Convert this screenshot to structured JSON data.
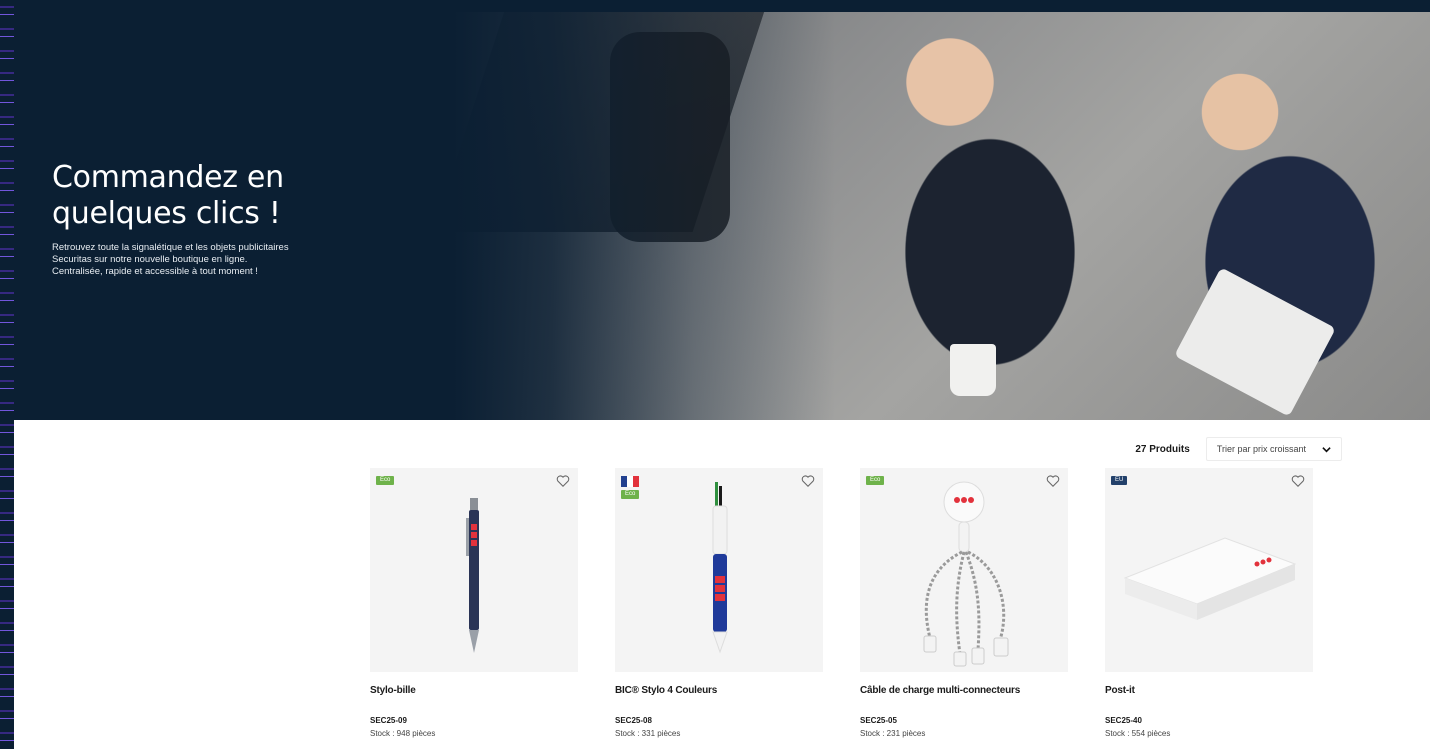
{
  "hero": {
    "title_line1": "Commandez en",
    "title_line2": "quelques clics !",
    "subtitle_line1": "Retrouvez toute la signalétique et les objets publicitaires",
    "subtitle_line2": "Securitas sur notre nouvelle boutique en ligne.",
    "subtitle_line3": "Centralisée, rapide et accessible à tout moment !"
  },
  "toolbar": {
    "count_label": "27 Produits",
    "sort_label": "Trier par prix croissant"
  },
  "products": [
    {
      "name": "Stylo-bille",
      "sku": "SEC25-09",
      "stock": "Stock : 948 pièces",
      "badge": "Eco",
      "flag": false
    },
    {
      "name": "BIC® Stylo 4 Couleurs",
      "sku": "SEC25-08",
      "stock": "Stock : 331 pièces",
      "badge": "Eco",
      "flag": true
    },
    {
      "name": "Câble de charge multi-connecteurs",
      "sku": "SEC25-05",
      "stock": "Stock : 231 pièces",
      "badge": "Eco",
      "flag": false
    },
    {
      "name": "Post-it",
      "sku": "SEC25-40",
      "stock": "Stock : 554 pièces",
      "badge": "EU",
      "flag": false
    }
  ],
  "colors": {
    "hero_bg": "#0b1f33",
    "eco_badge": "#6eb24a",
    "brand_red": "#e2323c"
  }
}
